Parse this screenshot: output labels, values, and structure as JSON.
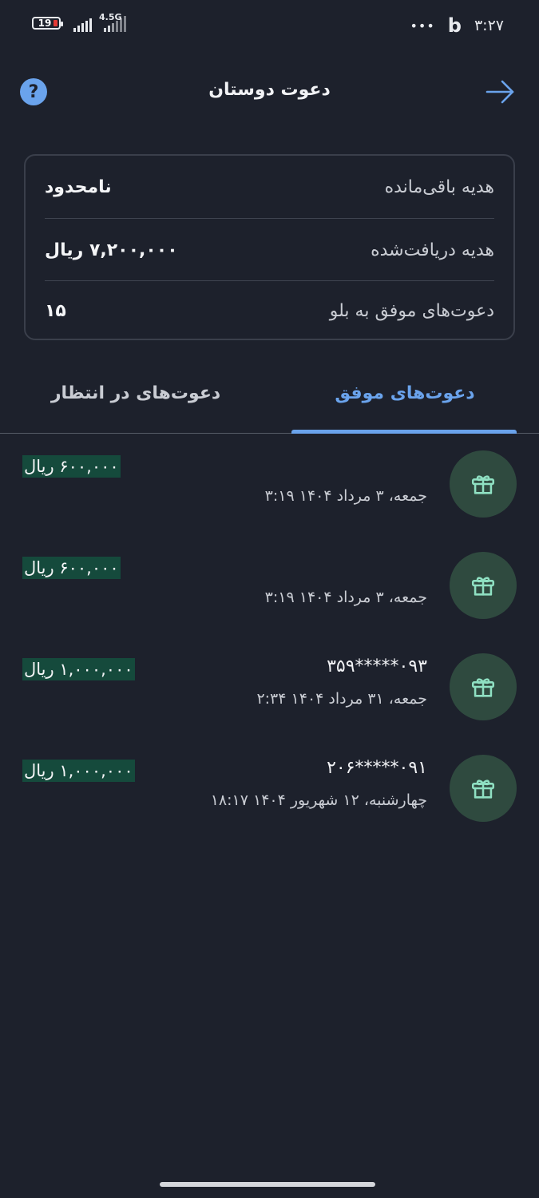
{
  "status_bar": {
    "battery": "19",
    "network": "4.5G",
    "time": "۳:۲۷",
    "dots": "•••",
    "app_logo": "b"
  },
  "header": {
    "title": "دعوت دوستان",
    "help_label": "?",
    "help_icon": "question-circle-icon",
    "back_icon": "arrow-right-icon"
  },
  "summary": {
    "rows": [
      {
        "label": "هدیه باقی‌مانده",
        "value": "نامحدود"
      },
      {
        "label": "هدیه دریافت‌شده",
        "value": "۷,۲۰۰,۰۰۰ ریال"
      },
      {
        "label": "دعوت‌های موفق به بلو",
        "value": "۱۵"
      }
    ]
  },
  "tabs": {
    "active": "دعوت‌های موفق",
    "inactive": "دعوت‌های در انتظار"
  },
  "invites": [
    {
      "name": "",
      "date": "جمعه، ۳ مرداد ۱۴۰۴ ۳:۱۹",
      "amount": "۶۰۰,۰۰۰ ریال"
    },
    {
      "name": "",
      "date": "جمعه، ۳ مرداد ۱۴۰۴ ۳:۱۹",
      "amount": "۶۰۰,۰۰۰ ریال"
    },
    {
      "name": "۰۹۳*****۳۵۹",
      "date": "جمعه، ۳۱ مرداد ۱۴۰۴ ۲:۳۴",
      "amount": "۱,۰۰۰,۰۰۰ ریال"
    },
    {
      "name": "۰۹۱*****۲۰۶",
      "date": "چهارشنبه، ۱۲ شهریور ۱۴۰۴ ۱۸:۱۷",
      "amount": "۱,۰۰۰,۰۰۰ ریال"
    }
  ],
  "colors": {
    "background": "#1d212c",
    "accent": "#6aa3ec",
    "gift_bg": "#2f4a3f",
    "gift_icon": "#8fe0c2",
    "amount_bg": "#154a3c"
  }
}
